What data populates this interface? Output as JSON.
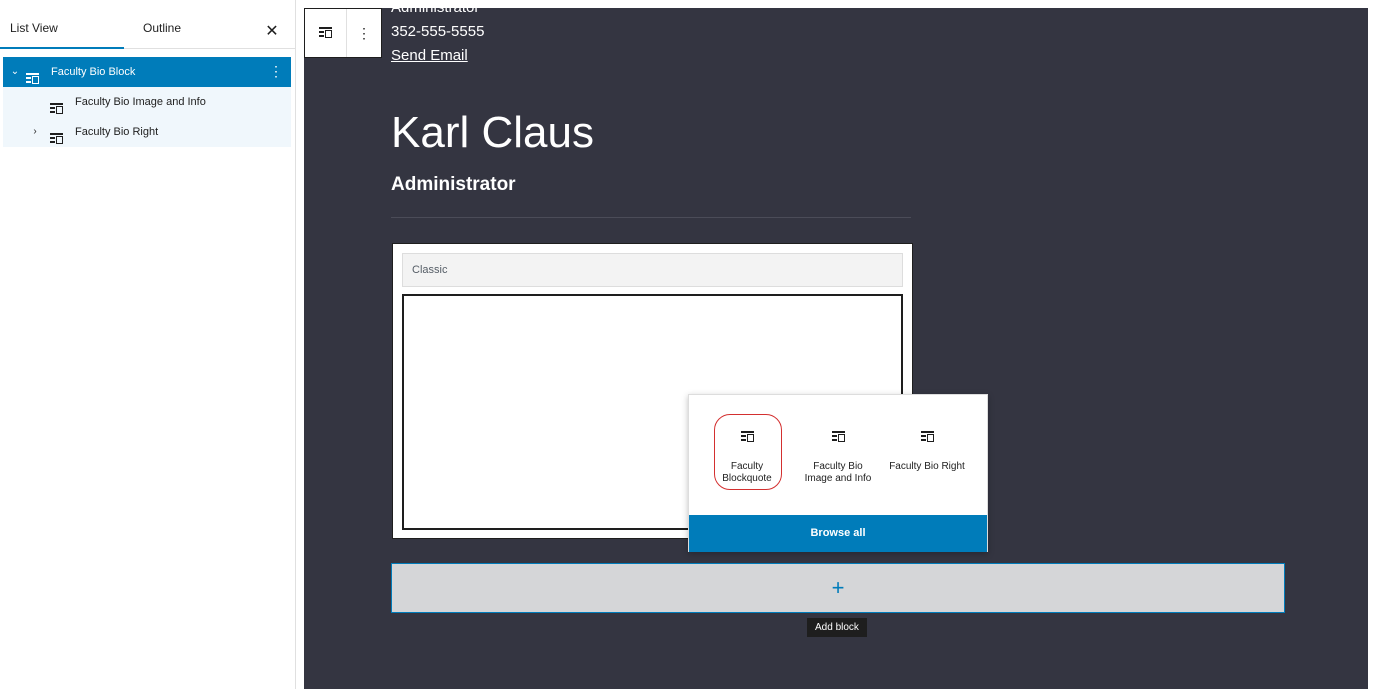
{
  "sidebar": {
    "tabs": [
      "List View",
      "Outline"
    ],
    "close_icon": "close-icon",
    "tree": [
      {
        "label": "Faculty Bio Block",
        "selected": true,
        "expanded": true
      },
      {
        "label": "Faculty Bio Image and Info",
        "selected": false
      },
      {
        "label": "Faculty Bio Right",
        "selected": false,
        "collapsed": true
      }
    ]
  },
  "toolbar": {
    "block_icon": "block-icon",
    "options_icon": "more-vertical-icon"
  },
  "profile": {
    "role_top": "Administrator",
    "phone": "352-555-5555",
    "email_link": "Send Email",
    "name": "Karl Claus",
    "position": "Administrator"
  },
  "classic_block": {
    "toolbar_label": "Classic"
  },
  "inserter": {
    "items": [
      {
        "label": "Faculty Blockquote",
        "icon": "block-icon"
      },
      {
        "label": "Faculty Bio Image and Info",
        "icon": "block-icon"
      },
      {
        "label": "Faculty Bio Right",
        "icon": "block-icon"
      }
    ],
    "browse_all": "Browse all"
  },
  "appender": {
    "icon": "plus-icon",
    "tooltip": "Add block"
  },
  "colors": {
    "accent": "#007cba",
    "canvas_bg": "#343541",
    "annotation_circle": "#d32f2f"
  }
}
